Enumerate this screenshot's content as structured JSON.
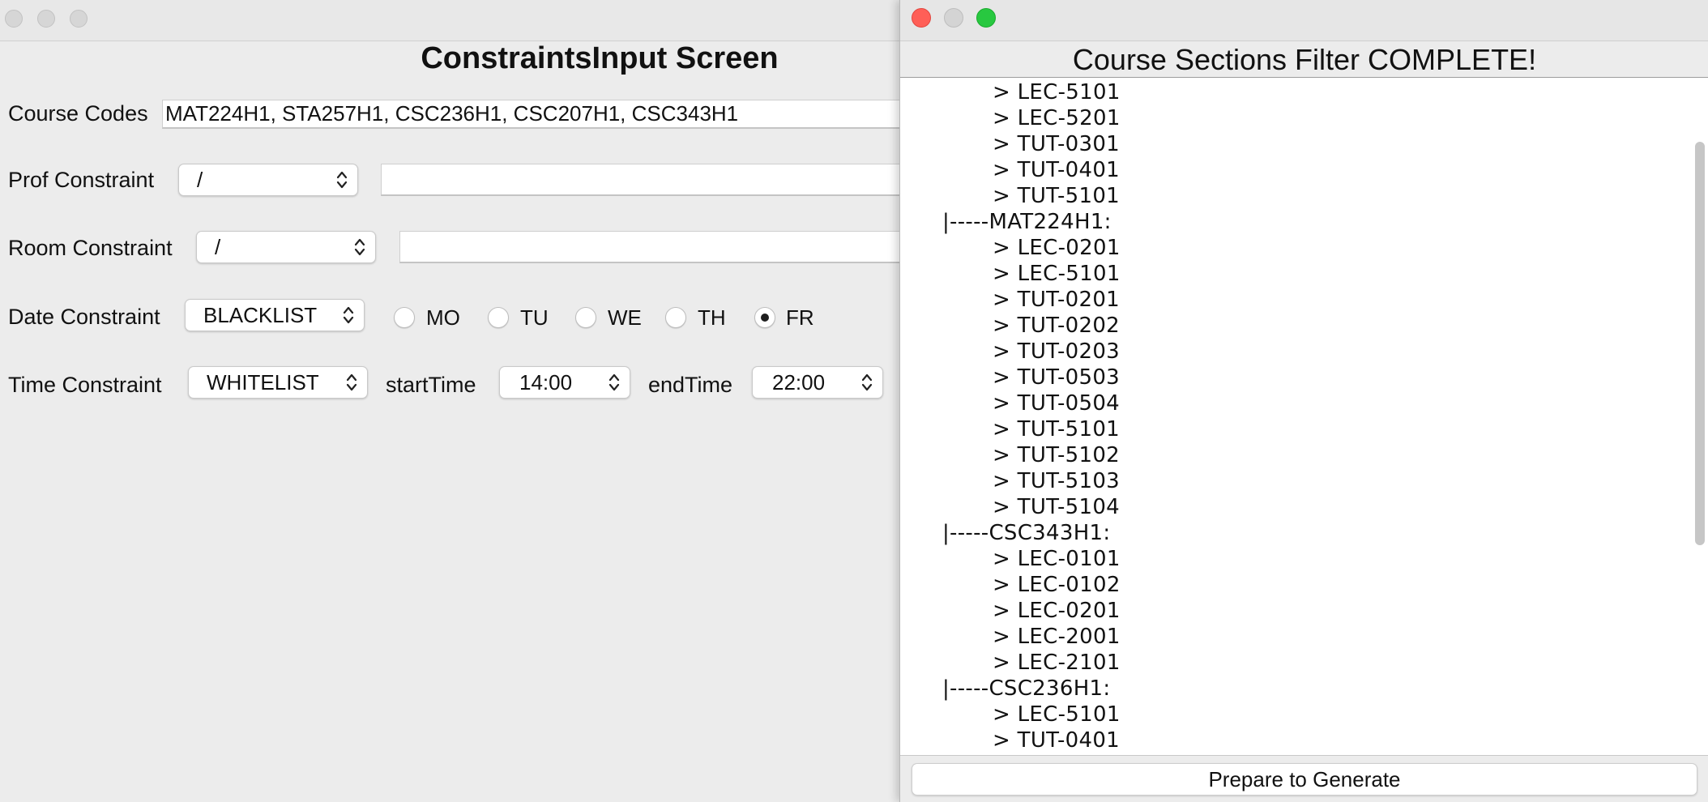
{
  "left_window": {
    "title": "ConstraintsInput Screen",
    "course_codes": {
      "label": "Course Codes",
      "value": "MAT224H1, STA257H1, CSC236H1, CSC207H1, CSC343H1"
    },
    "prof_constraint": {
      "label": "Prof Constraint",
      "mode": "/",
      "value": ""
    },
    "room_constraint": {
      "label": "Room Constraint",
      "mode": "/",
      "value": ""
    },
    "date_constraint": {
      "label": "Date Constraint",
      "mode": "BLACKLIST",
      "days": [
        {
          "label": "MO",
          "selected": false
        },
        {
          "label": "TU",
          "selected": false
        },
        {
          "label": "WE",
          "selected": false
        },
        {
          "label": "TH",
          "selected": false
        },
        {
          "label": "FR",
          "selected": true
        }
      ]
    },
    "time_constraint": {
      "label": "Time Constraint",
      "mode": "WHITELIST",
      "start_label": "startTime",
      "start_value": "14:00",
      "end_label": "endTime",
      "end_value": "22:00"
    }
  },
  "right_window": {
    "title": "Course Sections Filter COMPLETE!",
    "items": [
      "> LEC-5101",
      "> LEC-5201",
      "> TUT-0301",
      "> TUT-0401",
      "> TUT-5101",
      "|-----MAT224H1:",
      "> LEC-0201",
      "> LEC-5101",
      "> TUT-0201",
      "> TUT-0202",
      "> TUT-0203",
      "> TUT-0503",
      "> TUT-0504",
      "> TUT-5101",
      "> TUT-5102",
      "> TUT-5103",
      "> TUT-5104",
      "|-----CSC343H1:",
      "> LEC-0101",
      "> LEC-0102",
      "> LEC-0201",
      "> LEC-2001",
      "> LEC-2101",
      "|-----CSC236H1:",
      "> LEC-5101",
      "> TUT-0401"
    ],
    "button_label": "Prepare to Generate"
  },
  "colors": {
    "close": "#ff5f57",
    "minimize": "#d4d4d4",
    "zoom": "#28c840"
  },
  "icons": [
    "chevron-updown-icon",
    "radio-icon"
  ]
}
